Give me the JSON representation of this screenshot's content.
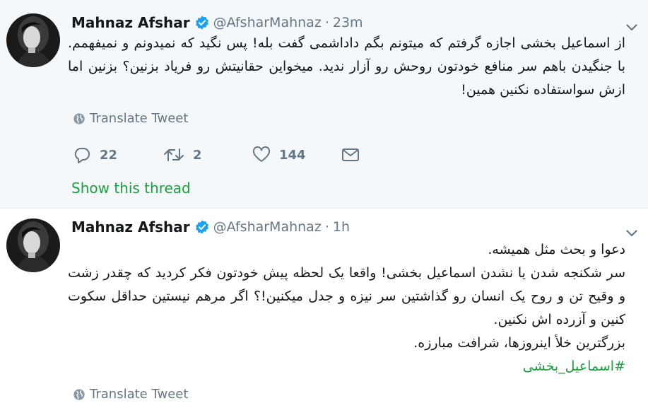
{
  "tweets": [
    {
      "author_name": "Mahnaz Afshar",
      "handle": "@AfsharMahnaz",
      "separator": "·",
      "time": "23m",
      "text_lines": [
        "از اسماعیل بخشی اجازه گرفتم که میتونم بگم داداشمی گفت بله! پس نگید که نمیدونم و نمیفهمم. با جنگیدن باهم سر منافع خودتون روحش رو آزار ندید. میخواین حقانیتش رو فریاد بزنین؟ بزنین اما ازش سواستفاده نکنین همین!"
      ],
      "translate_label": "Translate Tweet",
      "reply_count": "22",
      "retweet_count": "2",
      "like_count": "144",
      "show_thread_label": "Show this thread"
    },
    {
      "author_name": "Mahnaz Afshar",
      "handle": "@AfsharMahnaz",
      "separator": "·",
      "time": "1h",
      "text_lines": [
        "دعوا و بحث مثل همیشه.",
        "سر شکنجه شدن یا نشدن اسماعیل بخشی! واقعا یک لحظه پیش خودتون فکر کردید که چقدر زشت و وقیح تن و روح یک انسان رو گذاشتین سر نیزه و جدل میکنین!؟ اگر مرهم نیستین حداقل سکوت کنین و آزرده اش نکنین.",
        "بزرگترین خلأ اینروزها، شرافت مبارزه."
      ],
      "hashtag": "#اسماعیل_بخشی",
      "translate_label": "Translate Tweet"
    }
  ],
  "colors": {
    "link_green": "#1b9e3e",
    "verified_blue": "#1da1f2",
    "muted_gray": "#657786",
    "highlight_bg": "#f5f8fa"
  },
  "icons": {
    "verified": "verified-badge-icon",
    "caret": "chevron-down-icon",
    "globe": "globe-icon",
    "reply": "reply-icon",
    "retweet": "retweet-icon",
    "like": "heart-icon",
    "dm": "envelope-icon"
  }
}
